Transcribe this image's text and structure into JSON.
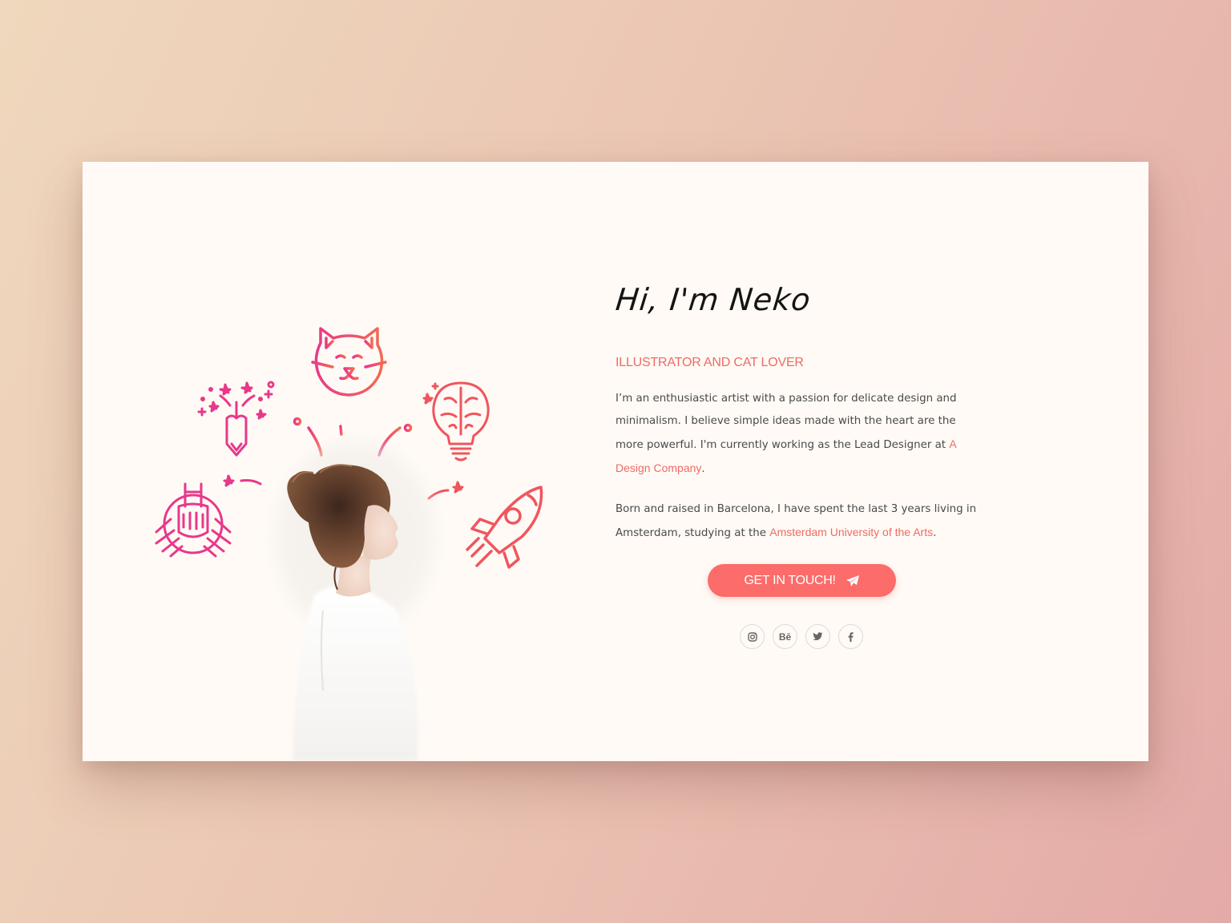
{
  "hero": {
    "headline": "Hi, I'm Neko",
    "role": "ILLUSTRATOR AND CAT LOVER",
    "bio_1_text": "I’m an enthusiastic artist with a passion for delicate design and minimalism. I believe simple ideas made with the heart are the more powerful. I'm currently working as the Lead Designer at ",
    "bio_1_link": "A Design Company",
    "bio_1_end": ".",
    "bio_2_text": "Born and raised in Barcelona, I have spent the last 3 years living in Amsterdam, studying at the ",
    "bio_2_link": "Amsterdam University of the Arts",
    "bio_2_end": "."
  },
  "cta": {
    "label": "GET IN TOUCH!",
    "icon": "paper-plane-icon"
  },
  "social": [
    {
      "name": "instagram",
      "icon": "instagram-icon"
    },
    {
      "name": "behance",
      "icon": "behance-icon",
      "label": "Bē"
    },
    {
      "name": "twitter",
      "icon": "twitter-icon"
    },
    {
      "name": "facebook",
      "icon": "facebook-icon"
    }
  ],
  "illustration": {
    "icons": [
      "cat-icon",
      "pencil-stars-icon",
      "brain-bulb-icon",
      "hands-together-icon",
      "rocket-icon"
    ]
  },
  "colors": {
    "accent": "#f06a65",
    "button": "#fb6c6a",
    "card_bg": "#fffaf5",
    "pink": "#e8388a"
  }
}
